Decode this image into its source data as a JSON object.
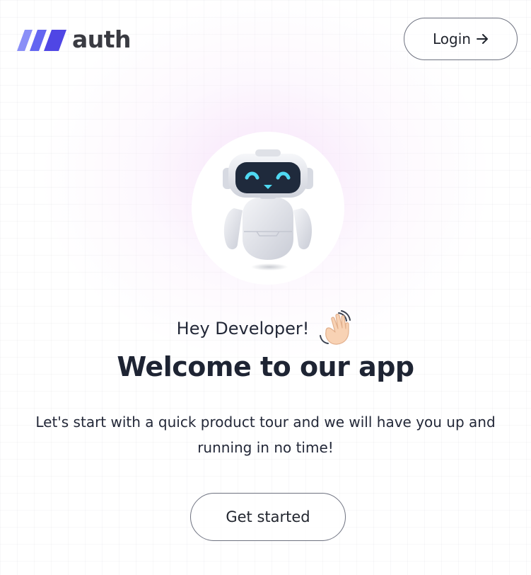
{
  "header": {
    "logo_text": "auth",
    "login_label": "Login",
    "login_icon": "arrow-right-icon"
  },
  "hero": {
    "illustration": "robot-illustration",
    "greeting": "Hey Developer!",
    "greeting_icon": "waving-hand-icon",
    "title": "Welcome to our app",
    "description": "Let's start with a quick product tour and we will have you up and running in no time!",
    "cta_label": "Get started"
  },
  "colors": {
    "brand_stripes": [
      "#7f84f6",
      "#6366f1",
      "#4f46e5"
    ],
    "text_dark": "#1e2433",
    "button_border": "#6e7280",
    "background_glow": "#f6e0fa"
  }
}
